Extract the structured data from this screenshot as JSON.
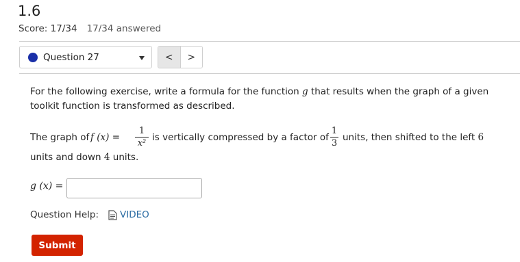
{
  "header": {
    "title": "1.6",
    "score": "Score: 17/34",
    "answered": "17/34 answered"
  },
  "question_nav": {
    "selected": "Question 27",
    "status_color": "#1a2fa8",
    "prev_label": "<",
    "next_label": ">"
  },
  "question": {
    "prompt_pre": "For the following exercise, write a formula for the function ",
    "prompt_var": "g",
    "prompt_post": " that results when the graph of a given toolkit function is transformed as described.",
    "statement_1": "The graph of ",
    "statement_func": "f (x) =",
    "frac1_num": "1",
    "frac1_den": "x²",
    "statement_2": "is vertically compressed by a factor of",
    "frac2_num": "1",
    "frac2_den": "3",
    "statement_3": "units, then shifted to the left ",
    "shift_left": "6",
    "statement_4": "units and down ",
    "shift_down": "4",
    "statement_5": " units.",
    "answer_label": "g (x) =",
    "answer_value": ""
  },
  "help": {
    "label": "Question Help:",
    "video_label": "VIDEO",
    "link_color": "#2b6ca3"
  },
  "actions": {
    "submit_label": "Submit",
    "submit_color": "#d32300"
  }
}
